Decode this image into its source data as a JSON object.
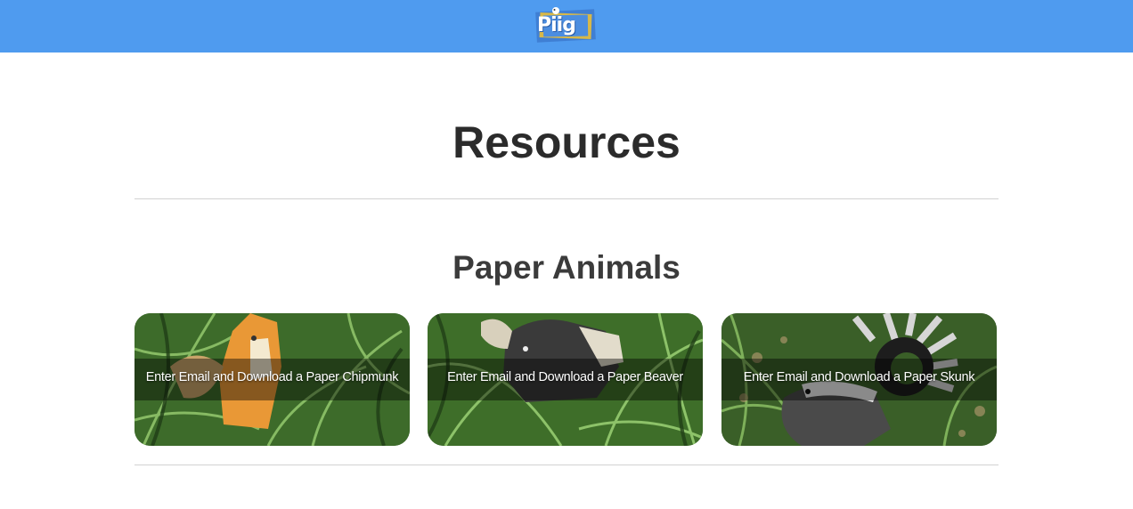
{
  "header": {
    "logo_text": "Piig",
    "colors": {
      "bar": "#4f9bef"
    }
  },
  "main": {
    "title": "Resources",
    "section_title": "Paper Animals",
    "cards": [
      {
        "label": "Enter Email and Download a Paper Chipmunk",
        "icon": "paper-chipmunk-photo"
      },
      {
        "label": "Enter Email and Download a Paper Beaver",
        "icon": "paper-beaver-photo"
      },
      {
        "label": "Enter Email and Download a Paper Skunk",
        "icon": "paper-skunk-photo"
      }
    ]
  }
}
